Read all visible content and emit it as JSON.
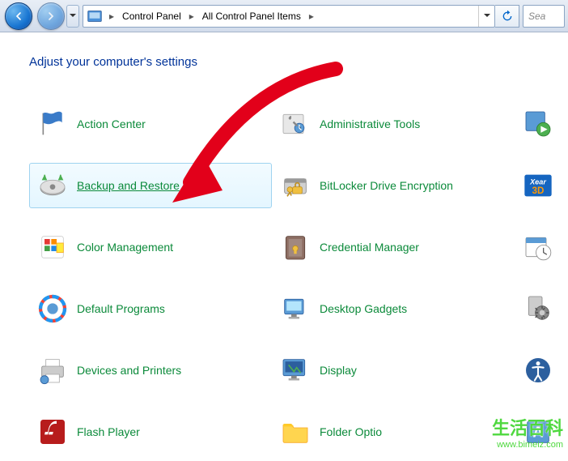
{
  "nav": {
    "breadcrumbs": [
      "Control Panel",
      "All Control Panel Items"
    ],
    "search_placeholder": "Sea"
  },
  "heading": "Adjust your computer's settings",
  "items_col1": [
    {
      "label": "Action Center",
      "icon": "flag"
    },
    {
      "label": "Backup and Restore",
      "icon": "backup",
      "selected": true
    },
    {
      "label": "Color Management",
      "icon": "color"
    },
    {
      "label": "Default Programs",
      "icon": "default"
    },
    {
      "label": "Devices and Printers",
      "icon": "printer"
    },
    {
      "label": "Flash Player",
      "icon": "flash"
    }
  ],
  "items_col2": [
    {
      "label": "Administrative Tools",
      "icon": "admin"
    },
    {
      "label": "BitLocker Drive Encryption",
      "icon": "bitlocker"
    },
    {
      "label": "Credential Manager",
      "icon": "credential"
    },
    {
      "label": "Desktop Gadgets",
      "icon": "gadgets"
    },
    {
      "label": "Display",
      "icon": "display"
    },
    {
      "label": "Folder Optio",
      "icon": "folder"
    }
  ],
  "items_col3": [
    {
      "icon": "autoplay"
    },
    {
      "icon": "xear3d"
    },
    {
      "icon": "datetime"
    },
    {
      "icon": "devicemgr"
    },
    {
      "icon": "ease"
    },
    {
      "icon": "fonts"
    }
  ],
  "watermark": {
    "text": "生活百科",
    "url": "www.bimeiz.com"
  }
}
